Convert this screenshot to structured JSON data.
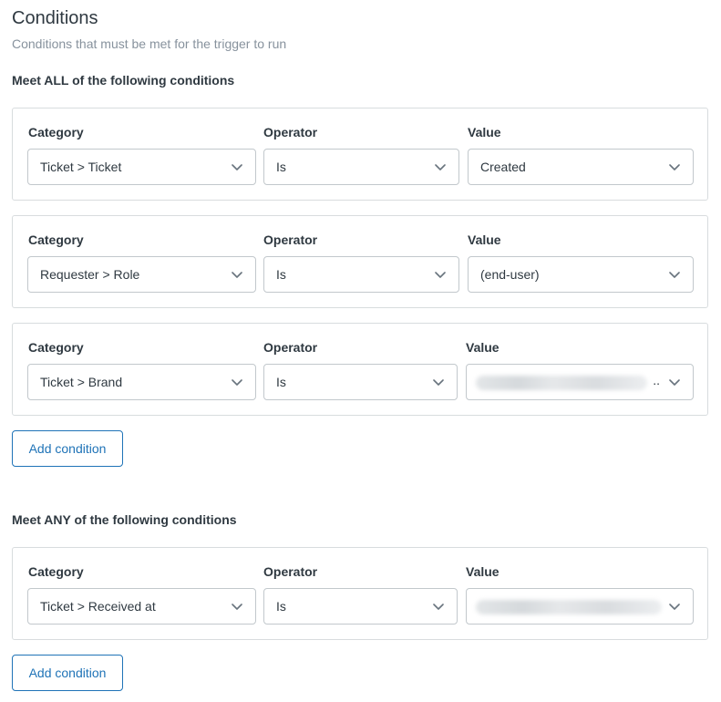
{
  "header": {
    "title": "Conditions",
    "subtitle": "Conditions that must be met for the trigger to run"
  },
  "labels": {
    "category": "Category",
    "operator": "Operator",
    "value": "Value"
  },
  "all_section": {
    "heading": "Meet ALL of the following conditions",
    "conditions": [
      {
        "category": "Ticket > Ticket",
        "operator": "Is",
        "value": "Created"
      },
      {
        "category": "Requester > Role",
        "operator": "Is",
        "value": "(end-user)"
      },
      {
        "category": "Ticket > Brand",
        "operator": "Is",
        "value_ellipsis": ".."
      }
    ],
    "add_label": "Add condition"
  },
  "any_section": {
    "heading": "Meet ANY of the following conditions",
    "conditions": [
      {
        "category": "Ticket > Received at",
        "operator": "Is"
      }
    ],
    "add_label": "Add condition"
  },
  "colors": {
    "accent": "#1f73b7",
    "border": "#d8dcde",
    "text": "#2f3941",
    "muted": "#87929d"
  },
  "icons": {
    "dropdown": "chevron-down-icon"
  }
}
